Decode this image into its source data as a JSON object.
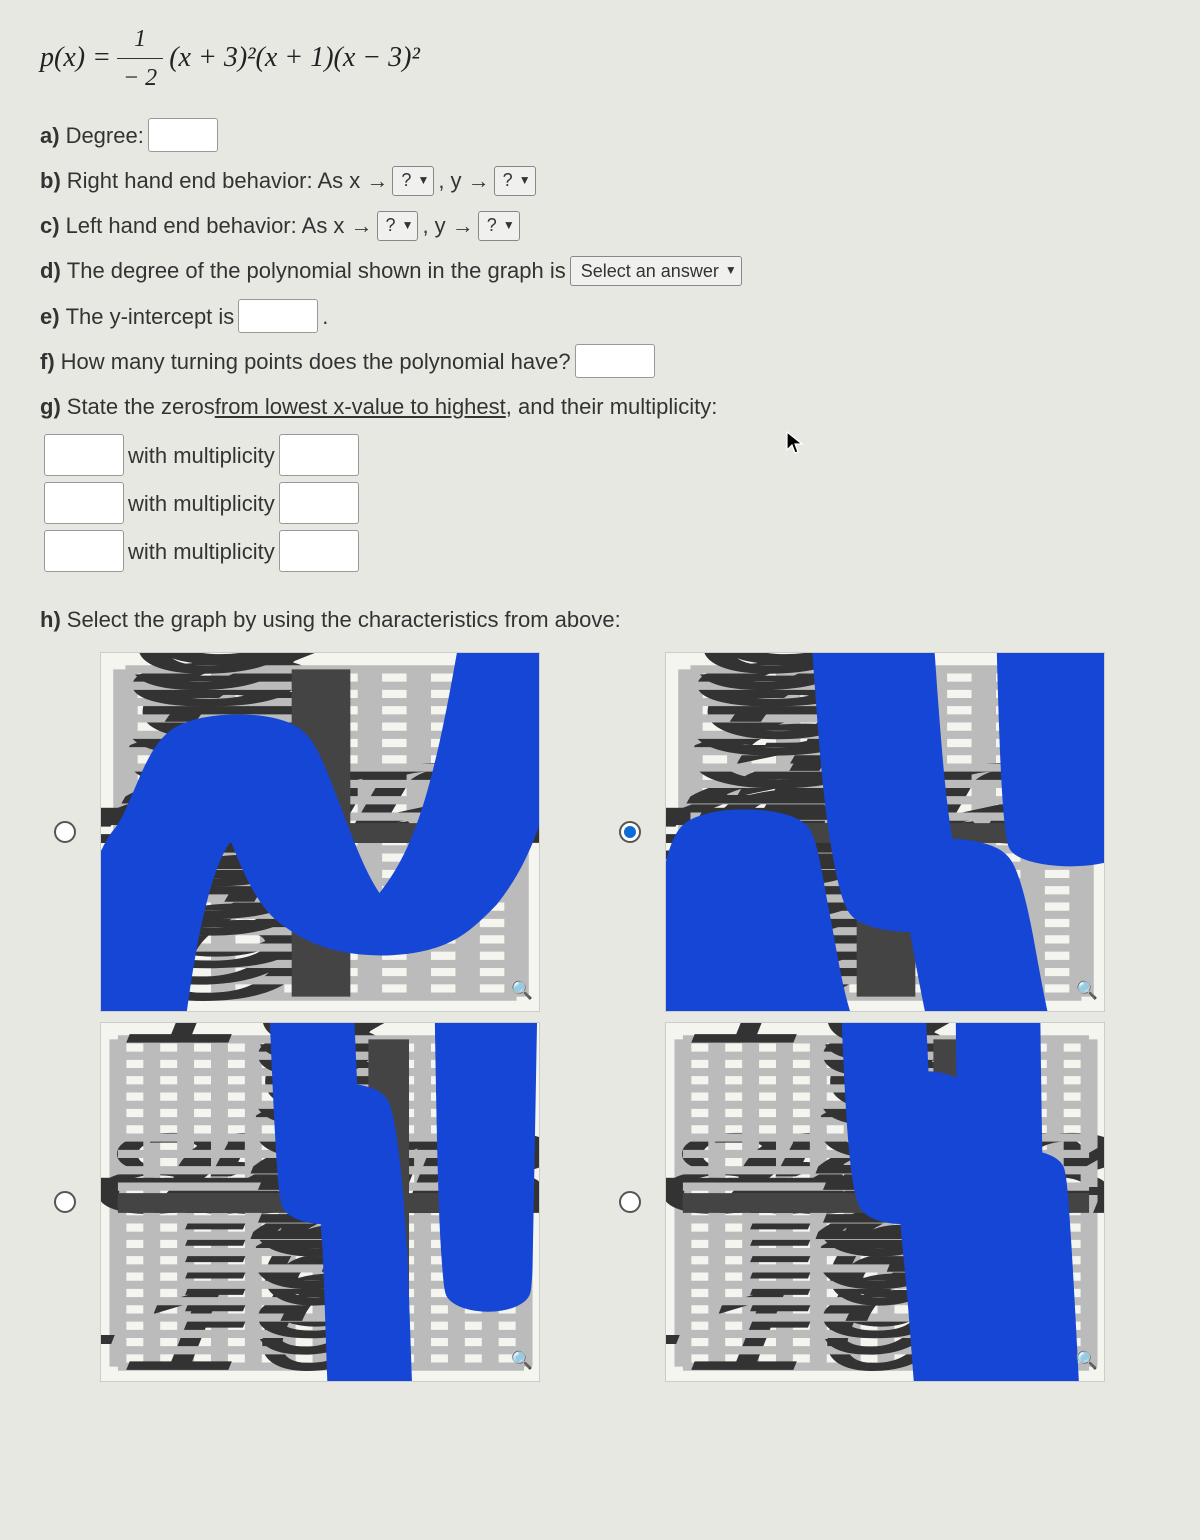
{
  "formula": {
    "lhs": "p(x) =",
    "num": "1",
    "den": "− 2",
    "rhs": "(x + 3)²(x + 1)(x − 3)²"
  },
  "a": {
    "label": "a)",
    "text": "Degree:"
  },
  "b": {
    "label": "b)",
    "text": "Right hand end behavior: As x →",
    "sep": ", y →"
  },
  "c": {
    "label": "c)",
    "text": "Left hand end behavior: As x →",
    "sep": ", y →"
  },
  "d": {
    "label": "d)",
    "text": "The degree of the polynomial shown in the graph is"
  },
  "e": {
    "label": "e)",
    "text": "The y-intercept is",
    "period": "."
  },
  "f": {
    "label": "f)",
    "text": "How many turning points does the polynomial have?"
  },
  "g": {
    "label": "g)",
    "pre": "State the zeros",
    "mid": " from lowest x-value to highest",
    "post": ", and their multiplicity:",
    "with": "with multiplicity"
  },
  "h": {
    "label": "h)",
    "text": "Select the graph by using the characteristics from above:"
  },
  "select": {
    "q": "?",
    "ans": "Select an answer"
  },
  "axis": {
    "xmin": -4,
    "xmax": 4,
    "ymin": -10,
    "ymax": 10,
    "xmin2": -8
  }
}
